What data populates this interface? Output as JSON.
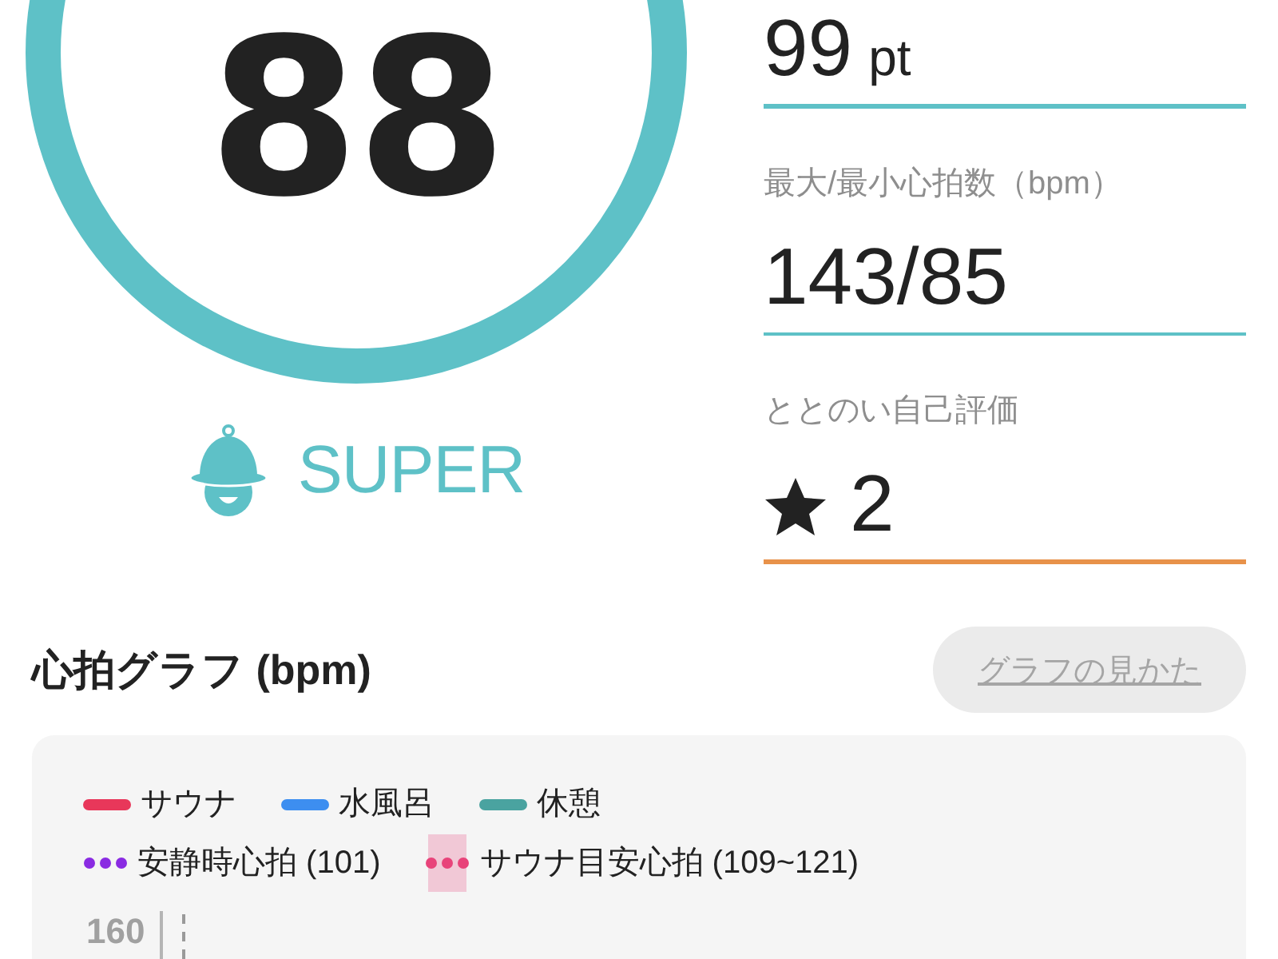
{
  "score": {
    "value": "88",
    "rank": "SUPER"
  },
  "stats": [
    {
      "kind": "number",
      "value": "99",
      "unit": "pt",
      "color": "#5ec1c7"
    },
    {
      "kind": "number",
      "label": "最大/最小心拍数（bpm）",
      "value": "143/85",
      "color": "#5ec1c7"
    },
    {
      "kind": "rating",
      "label": "ととのい自己評価",
      "value": "2",
      "color": "#e8924a"
    }
  ],
  "heart_graph": {
    "title": "心拍グラフ (bpm)",
    "help_button": "グラフの見かた",
    "legend": [
      {
        "items": [
          {
            "kind": "line",
            "label": "サウナ",
            "color": "#e8375a"
          },
          {
            "kind": "line",
            "label": "水風呂",
            "color": "#3d8ef0"
          },
          {
            "kind": "line",
            "label": "休憩",
            "color": "#4aa3a0"
          }
        ]
      },
      {
        "items": [
          {
            "kind": "dots",
            "label": "安静時心拍 (101)",
            "color": "#8a2be2"
          },
          {
            "kind": "band",
            "label": "サウナ目安心拍 (109~121)",
            "color": "#e8437a"
          }
        ]
      }
    ],
    "y_axis_labels": [
      "160"
    ]
  }
}
